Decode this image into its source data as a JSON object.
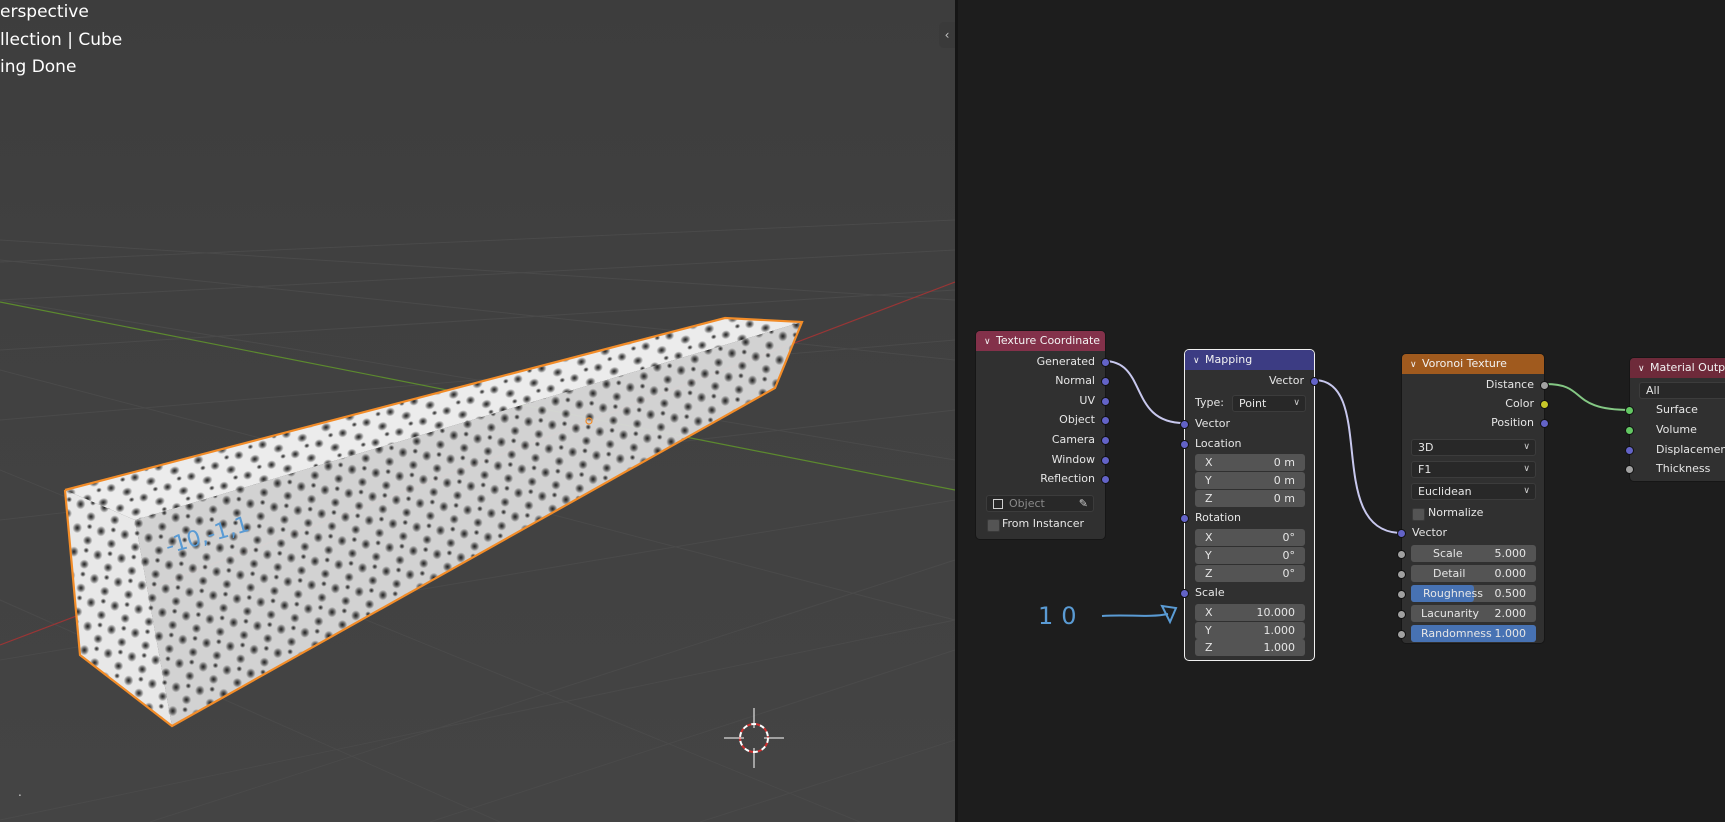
{
  "viewport": {
    "overlay_lines": [
      "erspective",
      "llection | Cube",
      "ing Done"
    ],
    "annotation_text": "-10,-1,1",
    "dot_text": "."
  },
  "node_editor": {
    "annotation_text": "10",
    "nodes": {
      "texture_coordinate": {
        "title": "Texture Coordinate",
        "header_color": "#83314a",
        "outputs": [
          "Generated",
          "Normal",
          "UV",
          "Object",
          "Camera",
          "Window",
          "Reflection"
        ],
        "object_placeholder": "Object",
        "from_instancer_label": "From Instancer"
      },
      "mapping": {
        "title": "Mapping",
        "header_color": "#3c3c83",
        "output_label": "Vector",
        "type_label": "Type:",
        "type_value": "Point",
        "vector_label": "Vector",
        "location_label": "Location",
        "location": [
          {
            "axis": "X",
            "value": "0 m"
          },
          {
            "axis": "Y",
            "value": "0 m"
          },
          {
            "axis": "Z",
            "value": "0 m"
          }
        ],
        "rotation_label": "Rotation",
        "rotation": [
          {
            "axis": "X",
            "value": "0°"
          },
          {
            "axis": "Y",
            "value": "0°"
          },
          {
            "axis": "Z",
            "value": "0°"
          }
        ],
        "scale_label": "Scale",
        "scale": [
          {
            "axis": "X",
            "value": "10.000"
          },
          {
            "axis": "Y",
            "value": "1.000"
          },
          {
            "axis": "Z",
            "value": "1.000"
          }
        ]
      },
      "voronoi_texture": {
        "title": "Voronoi Texture",
        "header_color": "#a05a1e",
        "outputs": [
          "Distance",
          "Color",
          "Position"
        ],
        "dimensions": "3D",
        "feature": "F1",
        "metric": "Euclidean",
        "normalize_label": "Normalize",
        "vector_label": "Vector",
        "inputs": [
          {
            "label": "Scale",
            "value": "5.000"
          },
          {
            "label": "Detail",
            "value": "0.000"
          },
          {
            "label": "Roughness",
            "value": "0.500",
            "fill": 0.5
          },
          {
            "label": "Lacunarity",
            "value": "2.000"
          },
          {
            "label": "Randomness",
            "value": "1.000",
            "fill": 1.0
          }
        ]
      },
      "material_output": {
        "title": "Material Output",
        "header_color": "#6e2a3a",
        "target": "All",
        "inputs": [
          "Surface",
          "Volume",
          "Displacement",
          "Thickness"
        ]
      }
    }
  },
  "colors": {
    "selection_outline": "#f28c28",
    "annotation": "#5a9bd4",
    "accent_blue": "#4772b3"
  }
}
